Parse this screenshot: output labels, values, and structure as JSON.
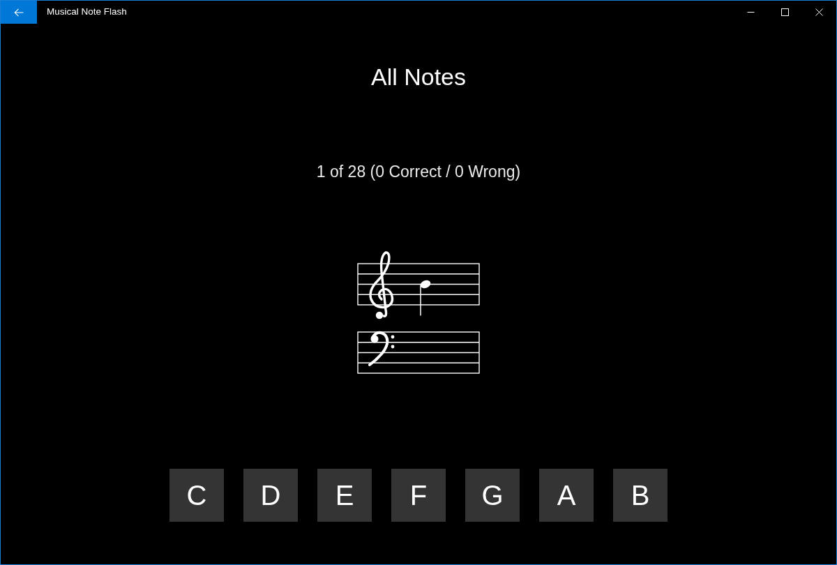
{
  "window": {
    "title": "Musical Note Flash"
  },
  "page": {
    "title": "All Notes",
    "progress": "1 of 28 (0 Correct / 0 Wrong)"
  },
  "staves": [
    {
      "kind": "treble",
      "note": true
    },
    {
      "kind": "bass",
      "note": false
    }
  ],
  "answer_buttons": [
    "C",
    "D",
    "E",
    "F",
    "G",
    "A",
    "B"
  ]
}
